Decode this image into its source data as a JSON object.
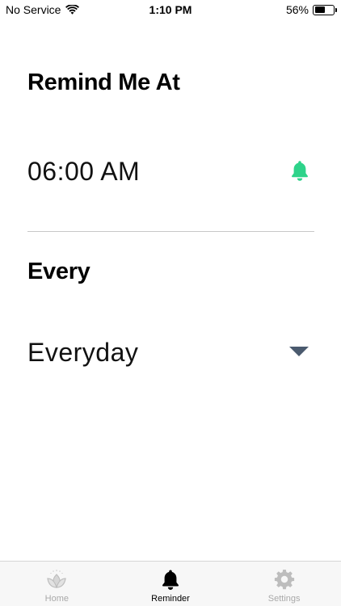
{
  "status_bar": {
    "carrier": "No Service",
    "time": "1:10 PM",
    "battery_percent": "56%",
    "battery_level": 0.56,
    "wifi_icon": "wifi-icon",
    "battery_icon": "battery-icon"
  },
  "reminder": {
    "title": "Remind Me At",
    "time": "06:00 AM",
    "bell_icon": "bell-icon",
    "bell_color": "#2ED38A"
  },
  "frequency": {
    "title": "Every",
    "value": "Everyday",
    "dropdown_icon": "triangle-down-icon",
    "dropdown_color": "#4A5A6E"
  },
  "tab_bar": {
    "tabs": [
      {
        "label": "Home",
        "icon": "lotus-icon",
        "active": false
      },
      {
        "label": "Reminder",
        "icon": "bell-icon",
        "active": true
      },
      {
        "label": "Settings",
        "icon": "gear-icon",
        "active": false
      }
    ],
    "active_color": "#000000",
    "inactive_color": "#A9A9A9"
  }
}
